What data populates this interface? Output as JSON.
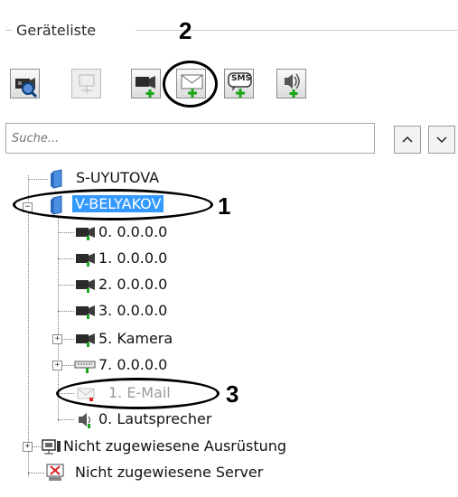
{
  "panel": {
    "title": "Geräteliste"
  },
  "annotations": [
    "1",
    "2",
    "3"
  ],
  "toolbar": {
    "buttons": [
      {
        "icon": "camera-search-icon",
        "tooltip": ""
      },
      {
        "icon": "disabled-node-icon",
        "tooltip": ""
      },
      {
        "icon": "add-camera-icon",
        "tooltip": ""
      },
      {
        "icon": "add-email-icon",
        "tooltip": ""
      },
      {
        "icon": "add-sms-icon",
        "tooltip": "",
        "text": "SMS"
      },
      {
        "icon": "add-speaker-icon",
        "tooltip": ""
      }
    ]
  },
  "search": {
    "placeholder": "Suche...",
    "up": "^",
    "down": "v"
  },
  "tree": {
    "server1": "S-UYUTOVA",
    "server2": "V-BELYAKOV",
    "items": [
      "0. 0.0.0.0",
      "1. 0.0.0.0",
      "2. 0.0.0.0",
      "3. 0.0.0.0",
      "5. Kamera",
      "7. 0.0.0.0",
      "1. E-Mail",
      "0. Lautsprecher"
    ],
    "unassigned_equipment": "Nicht zugewiesene Ausrüstung",
    "unassigned_servers": "Nicht zugewiesene Server"
  },
  "colors": {
    "selection": "#3399ff",
    "accent_green": "#1aa51a"
  }
}
